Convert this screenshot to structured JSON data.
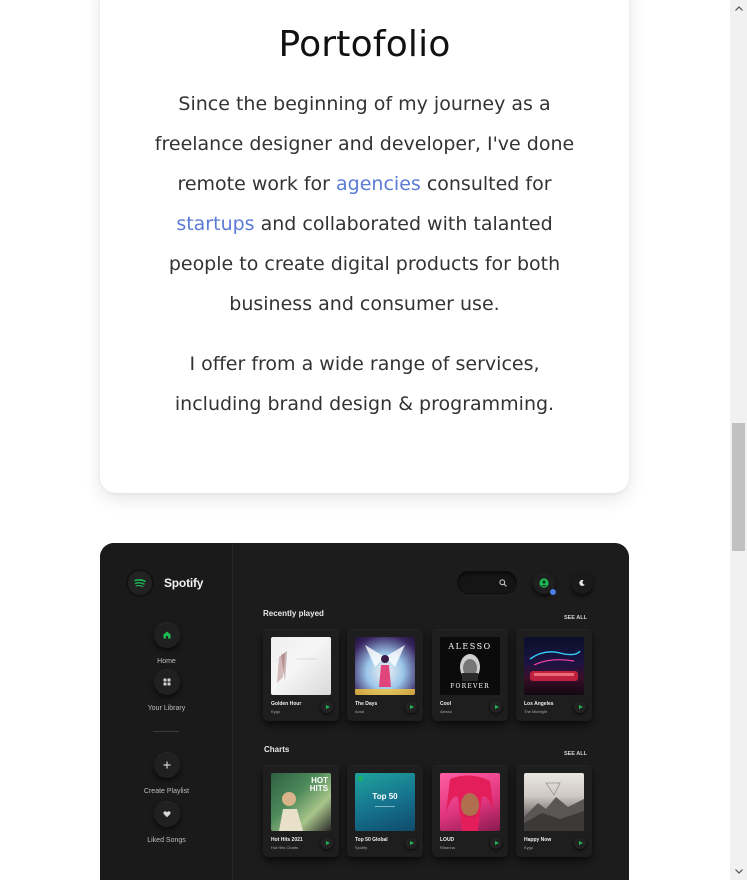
{
  "portfolio": {
    "title": "Portofolio",
    "p1_a": "Since the beginning of my journey as a freelance designer and developer, I've done remote work for ",
    "link_agencies": "agencies",
    "p1_b": " consulted for ",
    "link_startups": "startups",
    "p1_c": " and collaborated with talanted people to create digital products for both business and consumer use.",
    "p2": "I offer from a wide range of services, including brand design & programming.",
    "link_color": "#5b7bd5"
  },
  "spotify": {
    "brand": "Spotify",
    "accent": "#1db954",
    "nav": [
      {
        "label": "Home",
        "icon": "home-icon"
      },
      {
        "label": "Your Library",
        "icon": "grid-icon"
      },
      {
        "label": "Create Playlist",
        "icon": "plus-icon"
      },
      {
        "label": "Liked Songs",
        "icon": "heart-icon"
      }
    ],
    "recent_title": "Recently played",
    "charts_title": "Charts",
    "see_all": "SEE ALL",
    "recent": [
      {
        "name": "Golden Hour",
        "artist": "Kygo"
      },
      {
        "name": "The Days",
        "artist": "Avicii"
      },
      {
        "name": "Cool",
        "artist": "Alesso",
        "art_top": "ALESSO",
        "art_bottom": "FOREVER"
      },
      {
        "name": "Los Angeles",
        "artist": "The Midnight"
      }
    ],
    "charts": [
      {
        "name": "Hot Hits 2021",
        "artist": "Hot Hits Charts",
        "art_text": "HOT HITS"
      },
      {
        "name": "Top 50 Global",
        "artist": "Spotify",
        "art_text": "Top 50"
      },
      {
        "name": "LOUD",
        "artist": "Rihanna"
      },
      {
        "name": "Happy Now",
        "artist": "Kygo"
      }
    ]
  }
}
